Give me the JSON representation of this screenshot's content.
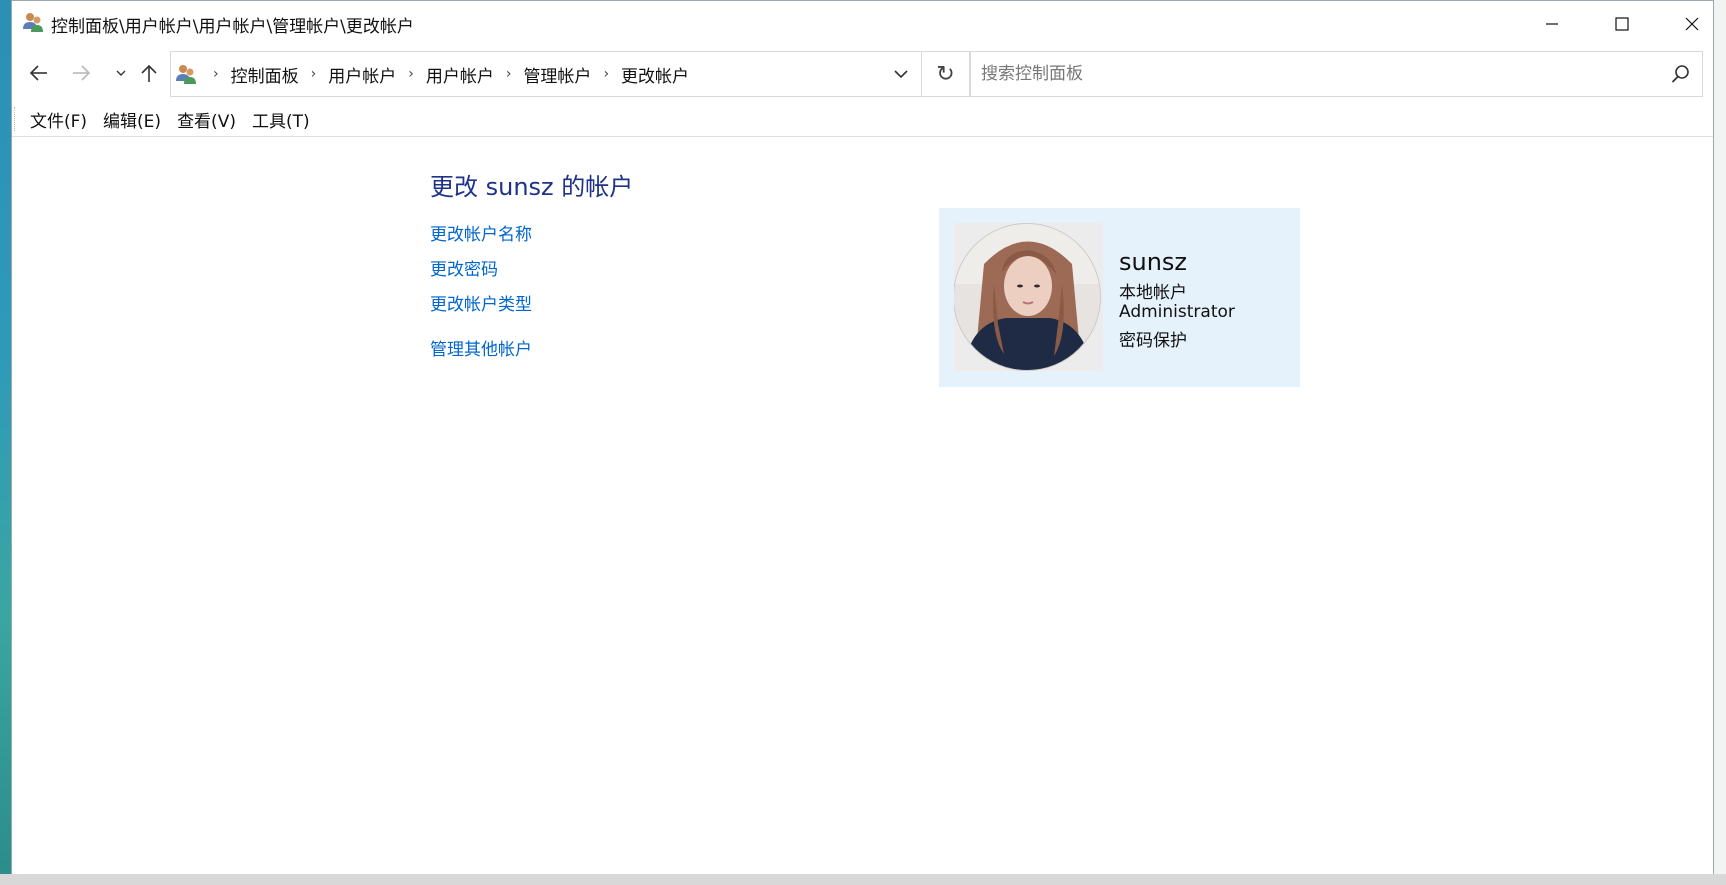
{
  "window": {
    "title": "控制面板\\用户帐户\\用户帐户\\管理帐户\\更改帐户"
  },
  "nav": {
    "breadcrumbs": [
      "控制面板",
      "用户帐户",
      "用户帐户",
      "管理帐户",
      "更改帐户"
    ],
    "search_placeholder": "搜索控制面板"
  },
  "menu": {
    "items": [
      "文件(F)",
      "编辑(E)",
      "查看(V)",
      "工具(T)"
    ]
  },
  "content": {
    "heading": "更改 sunsz 的帐户",
    "links": [
      "更改帐户名称",
      "更改密码",
      "更改帐户类型",
      "管理其他帐户"
    ]
  },
  "account": {
    "name": "sunsz",
    "type": "本地帐户",
    "role": "Administrator",
    "protection": "密码保护"
  },
  "colors": {
    "heading": "#1e3287",
    "link": "#0066cc",
    "card_bg": "#e5f1fb"
  },
  "icons": [
    "users-icon",
    "back-arrow-icon",
    "forward-arrow-icon",
    "recent-dropdown-icon",
    "up-arrow-icon",
    "chevron-down-icon",
    "refresh-icon",
    "search-icon",
    "minimize-icon",
    "maximize-icon",
    "close-icon"
  ]
}
